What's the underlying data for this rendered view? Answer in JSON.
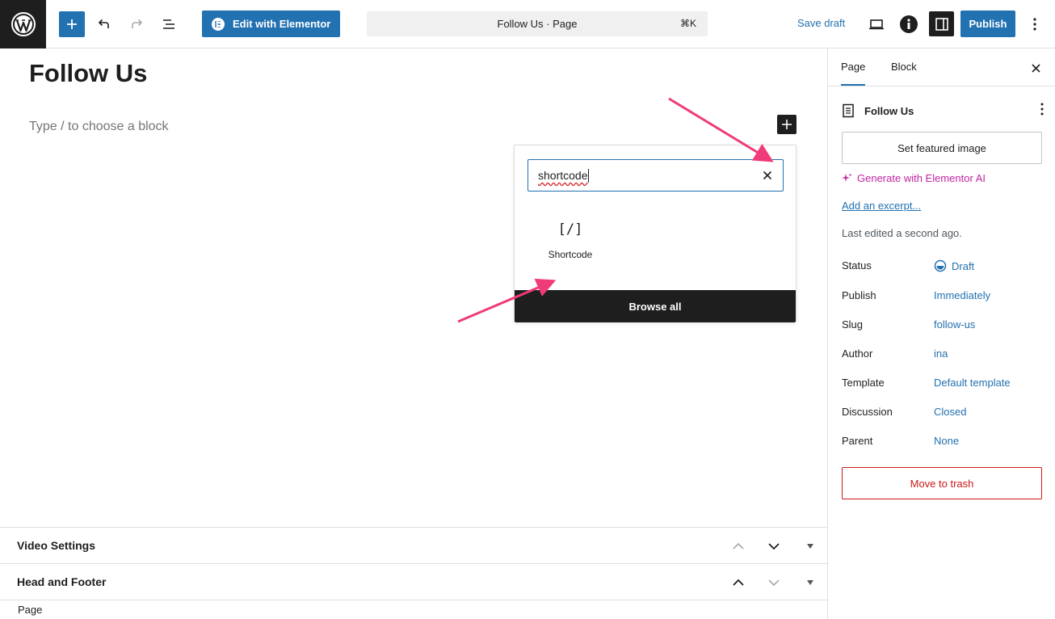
{
  "topbar": {
    "elementor_label": "Edit with Elementor",
    "document_title": "Follow Us · Page",
    "shortcut": "⌘K",
    "save_draft": "Save draft",
    "publish": "Publish"
  },
  "editor": {
    "title": "Follow Us",
    "placeholder": "Type / to choose a block"
  },
  "inserter": {
    "search_value": "shortcode",
    "result": {
      "icon": "[/]",
      "label": "Shortcode"
    },
    "browse_all": "Browse all"
  },
  "metaboxes": [
    {
      "title": "Video Settings"
    },
    {
      "title": "Head and Footer"
    }
  ],
  "footer": {
    "breadcrumb": "Page"
  },
  "sidebar": {
    "tabs": [
      "Page",
      "Block"
    ],
    "active_tab": "Page",
    "document_name": "Follow Us",
    "featured_image": "Set featured image",
    "generate_ai": "Generate with Elementor AI",
    "add_excerpt": "Add an excerpt...",
    "last_edited": "Last edited a second ago.",
    "properties": [
      {
        "label": "Status",
        "value": "Draft"
      },
      {
        "label": "Publish",
        "value": "Immediately"
      },
      {
        "label": "Slug",
        "value": "follow-us"
      },
      {
        "label": "Author",
        "value": "ina"
      },
      {
        "label": "Template",
        "value": "Default template"
      },
      {
        "label": "Discussion",
        "value": "Closed"
      },
      {
        "label": "Parent",
        "value": "None"
      }
    ],
    "trash": "Move to trash"
  },
  "colors": {
    "accent": "#2271b1",
    "dark": "#1e1e1e",
    "danger": "#cc1818",
    "ai": "#c026a0",
    "annotation_arrow": "#ef3b7a"
  }
}
